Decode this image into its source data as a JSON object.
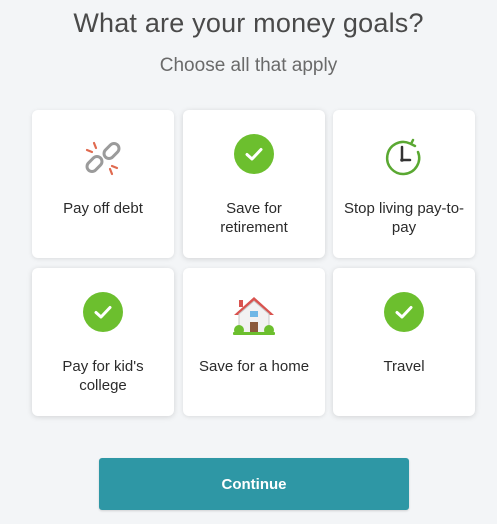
{
  "header": {
    "title": "What are your money goals?",
    "subtitle": "Choose all that apply"
  },
  "goals": [
    {
      "label": "Pay off debt",
      "icon": "broken-chain-icon",
      "selected": false
    },
    {
      "label": "Save for retirement",
      "icon": "check-icon",
      "selected": true
    },
    {
      "label": "Stop living pay-to-pay",
      "icon": "clock-icon",
      "selected": false
    },
    {
      "label": "Pay for kid's college",
      "icon": "check-icon",
      "selected": true
    },
    {
      "label": "Save for a home",
      "icon": "house-icon",
      "selected": false
    },
    {
      "label": "Travel",
      "icon": "check-icon",
      "selected": true
    }
  ],
  "actions": {
    "continue_label": "Continue"
  },
  "colors": {
    "background": "#f3f5f7",
    "check_green": "#6cbf2e",
    "button_teal": "#2e97a5",
    "clock_green": "#5aa832",
    "chain_gray": "#9b9b9b",
    "chain_accent": "#e06a4f"
  }
}
